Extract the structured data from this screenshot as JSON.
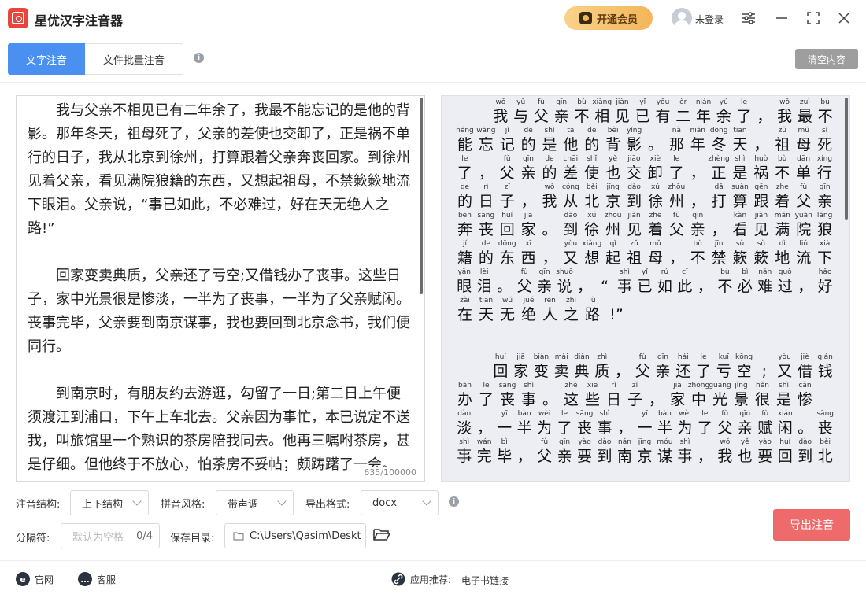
{
  "app": {
    "title": "星优汉字注音器",
    "vip_label": "开通会员",
    "login_label": "未登录"
  },
  "tabs": [
    {
      "label": "文字注音",
      "active": true
    },
    {
      "label": "文件批量注音",
      "active": false
    }
  ],
  "toolbar": {
    "clear_label": "清空内容"
  },
  "editor": {
    "paragraphs": [
      "我与父亲不相见已有二年余了，我最不能忘记的是他的背影。那年冬天，祖母死了，父亲的差使也交卸了，正是祸不单行的日子，我从北京到徐州，打算跟着父亲奔丧回家。到徐州见着父亲，看见满院狼籍的东西，又想起祖母，不禁簌簌地流下眼泪。父亲说，“事已如此，不必难过，好在天无绝人之路!”",
      "回家变卖典质，父亲还了亏空;又借钱办了丧事。这些日子，家中光景很是惨淡，一半为了丧事，一半为了父亲赋闲。丧事完毕，父亲要到南京谋事，我也要回到北京念书，我们便同行。",
      "到南京时，有朋友约去游逛，勾留了一日;第二日上午便须渡江到浦口，下午上车北去。父亲因为事忙，本已说定不送我，叫旅馆里一个熟识的茶房陪我同去。他再三嘱咐茶房，甚是仔细。但他终于不放心，怕茶房不妥帖；颇踌躇了一会。"
    ],
    "char_count": "635/100000"
  },
  "preview": {
    "lines": [
      {
        "indent": 2,
        "chars": [
          "我",
          "与",
          "父",
          "亲",
          "不",
          "相",
          "见",
          "已",
          "有",
          "二",
          "年",
          "余",
          "了",
          "，",
          "我",
          "最",
          "不"
        ],
        "pinyin": [
          "wǒ",
          "yǔ",
          "fù",
          "qīn",
          "bù",
          "xiāng",
          "jiàn",
          "yǐ",
          "yǒu",
          "èr",
          "nián",
          "yú",
          "le",
          "",
          "wǒ",
          "zuì",
          "bù"
        ]
      },
      {
        "indent": 0,
        "chars": [
          "能",
          "忘",
          "记",
          "的",
          "是",
          "他",
          "的",
          "背",
          "影",
          "。",
          "那",
          "年",
          "冬",
          "天",
          "，",
          "祖",
          "母",
          "死"
        ],
        "pinyin": [
          "néng",
          "wàng",
          "jì",
          "de",
          "shì",
          "tā",
          "de",
          "bèi",
          "yǐng",
          "",
          "nà",
          "nián",
          "dōng",
          "tiān",
          "",
          "zǔ",
          "mǔ",
          "sǐ"
        ]
      },
      {
        "indent": 0,
        "chars": [
          "了",
          "，",
          "父",
          "亲",
          "的",
          "差",
          "使",
          "也",
          "交",
          "卸",
          "了",
          "，",
          "正",
          "是",
          "祸",
          "不",
          "单",
          "行"
        ],
        "pinyin": [
          "le",
          "",
          "fù",
          "qīn",
          "de",
          "chāi",
          "shǐ",
          "yě",
          "jiāo",
          "xiè",
          "le",
          "",
          "zhèng",
          "shì",
          "huò",
          "bù",
          "dān",
          "xíng"
        ]
      },
      {
        "indent": 0,
        "chars": [
          "的",
          "日",
          "子",
          "，",
          "我",
          "从",
          "北",
          "京",
          "到",
          "徐",
          "州",
          "，",
          "打",
          "算",
          "跟",
          "着",
          "父",
          "亲"
        ],
        "pinyin": [
          "de",
          "rì",
          "zǐ",
          "",
          "wǒ",
          "cóng",
          "běi",
          "jīng",
          "dào",
          "xú",
          "zhōu",
          "",
          "dǎ",
          "suàn",
          "gēn",
          "zhe",
          "fù",
          "qīn"
        ]
      },
      {
        "indent": 0,
        "chars": [
          "奔",
          "丧",
          "回",
          "家",
          "。",
          "到",
          "徐",
          "州",
          "见",
          "着",
          "父",
          "亲",
          "，",
          "看",
          "见",
          "满",
          "院",
          "狼"
        ],
        "pinyin": [
          "bēn",
          "sāng",
          "huí",
          "jiā",
          "",
          "dào",
          "xú",
          "zhōu",
          "jiàn",
          "zhe",
          "fù",
          "qīn",
          "",
          "kàn",
          "jiàn",
          "mǎn",
          "yuàn",
          "láng"
        ]
      },
      {
        "indent": 0,
        "chars": [
          "籍",
          "的",
          "东",
          "西",
          "，",
          "又",
          "想",
          "起",
          "祖",
          "母",
          "，",
          "不",
          "禁",
          "簌",
          "簌",
          "地",
          "流",
          "下"
        ],
        "pinyin": [
          "jí",
          "de",
          "dōng",
          "xī",
          "",
          "yòu",
          "xiǎng",
          "qǐ",
          "zǔ",
          "mǔ",
          "",
          "bù",
          "jīn",
          "sù",
          "sù",
          "dì",
          "liú",
          "xià"
        ]
      },
      {
        "indent": 0,
        "chars": [
          "眼",
          "泪",
          "。",
          "父",
          "亲",
          "说",
          "，",
          "“",
          "事",
          "已",
          "如",
          "此",
          "，",
          "不",
          "必",
          "难",
          "过",
          "，",
          "好"
        ],
        "pinyin": [
          "yǎn",
          "lèi",
          "",
          "fù",
          "qīn",
          "shuō",
          "",
          "",
          "shì",
          "yǐ",
          "rú",
          "cǐ",
          "",
          "bù",
          "bì",
          "nán",
          "guò",
          "",
          "hǎo"
        ]
      },
      {
        "indent": 0,
        "chars": [
          "在",
          "天",
          "无",
          "绝",
          "人",
          "之",
          "路",
          "!”"
        ],
        "pinyin": [
          "zài",
          "tiān",
          "wú",
          "jué",
          "rén",
          "zhī",
          "lù",
          ""
        ]
      },
      {
        "gap": true
      },
      {
        "indent": 2,
        "chars": [
          "回",
          "家",
          "变",
          "卖",
          "典",
          "质",
          "，",
          "父",
          "亲",
          "还",
          "了",
          "亏",
          "空",
          ";",
          "又",
          "借",
          "钱"
        ],
        "pinyin": [
          "huí",
          "jiā",
          "biàn",
          "mài",
          "diǎn",
          "zhì",
          "",
          "fù",
          "qīn",
          "hái",
          "le",
          "kuī",
          "kōng",
          "",
          "yòu",
          "jiè",
          "qián"
        ]
      },
      {
        "indent": 0,
        "chars": [
          "办",
          "了",
          "丧",
          "事",
          "。",
          "这",
          "些",
          "日",
          "子",
          "，",
          "家",
          "中",
          "光",
          "景",
          "很",
          "是",
          "惨"
        ],
        "pinyin": [
          "bàn",
          "le",
          "sāng",
          "shì",
          "",
          "zhè",
          "xiē",
          "rì",
          "zǐ",
          "",
          "jiā",
          "zhōng",
          "guāng",
          "jǐng",
          "hěn",
          "shì",
          "cǎn"
        ]
      },
      {
        "indent": 0,
        "chars": [
          "淡",
          "，",
          "一",
          "半",
          "为",
          "了",
          "丧",
          "事",
          "，",
          "一",
          "半",
          "为",
          "了",
          "父",
          "亲",
          "赋",
          "闲",
          "。",
          "丧"
        ],
        "pinyin": [
          "dàn",
          "",
          "yī",
          "bàn",
          "wèi",
          "le",
          "sāng",
          "shì",
          "",
          "yī",
          "bàn",
          "wèi",
          "le",
          "fù",
          "qīn",
          "fù",
          "xián",
          "",
          "sāng"
        ]
      },
      {
        "indent": 0,
        "chars": [
          "事",
          "完",
          "毕",
          "，",
          "父",
          "亲",
          "要",
          "到",
          "南",
          "京",
          "谋",
          "事",
          "，",
          "我",
          "也",
          "要",
          "回",
          "到",
          "北"
        ],
        "pinyin": [
          "shì",
          "wán",
          "bì",
          "",
          "fù",
          "qīn",
          "yào",
          "dào",
          "nán",
          "jīng",
          "móu",
          "shì",
          "",
          "wǒ",
          "yě",
          "yào",
          "huí",
          "dào",
          "běi"
        ]
      }
    ]
  },
  "form": {
    "structure_label": "注音结构:",
    "structure_value": "上下结构",
    "style_label": "拼音风格:",
    "style_value": "带声调",
    "format_label": "导出格式:",
    "format_value": "docx",
    "separator_label": "分隔符:",
    "separator_placeholder": "默认为空格",
    "separator_count": "0/4",
    "save_dir_label": "保存目录:",
    "save_dir_value": "C:\\Users\\Qasim\\Deskto",
    "export_label": "导出注音"
  },
  "footer": {
    "official_label": "官网",
    "service_label": "客服",
    "recommend_label": "应用推荐:",
    "recommend_link": "电子书链接"
  },
  "colors": {
    "accent": "#4a90f0",
    "export": "#ef6b6b",
    "vip": "#f3b55a"
  }
}
